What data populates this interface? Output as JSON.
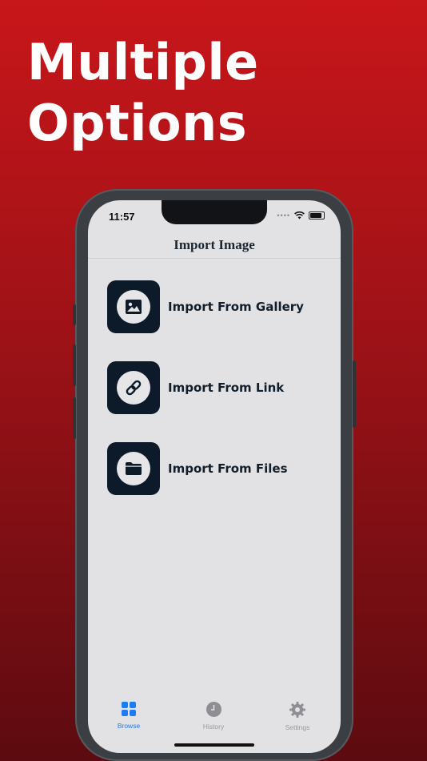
{
  "headline": {
    "line1": "Multiple",
    "line2": "Options"
  },
  "status_bar": {
    "time": "11:57"
  },
  "page": {
    "title": "Import Image"
  },
  "options": [
    {
      "label": "Import From Gallery",
      "icon": "image-icon"
    },
    {
      "label": "Import From Link",
      "icon": "link-icon"
    },
    {
      "label": "Import From Files",
      "icon": "folder-icon"
    }
  ],
  "tabs": [
    {
      "label": "Browse",
      "icon": "grid-icon",
      "active": true
    },
    {
      "label": "History",
      "icon": "clock-icon",
      "active": false
    },
    {
      "label": "Settings",
      "icon": "gear-icon",
      "active": false
    }
  ],
  "colors": {
    "background_top": "#c8161a",
    "background_bottom": "#5c0b10",
    "tile": "#0d1a2a",
    "accent": "#1c7cf4"
  }
}
